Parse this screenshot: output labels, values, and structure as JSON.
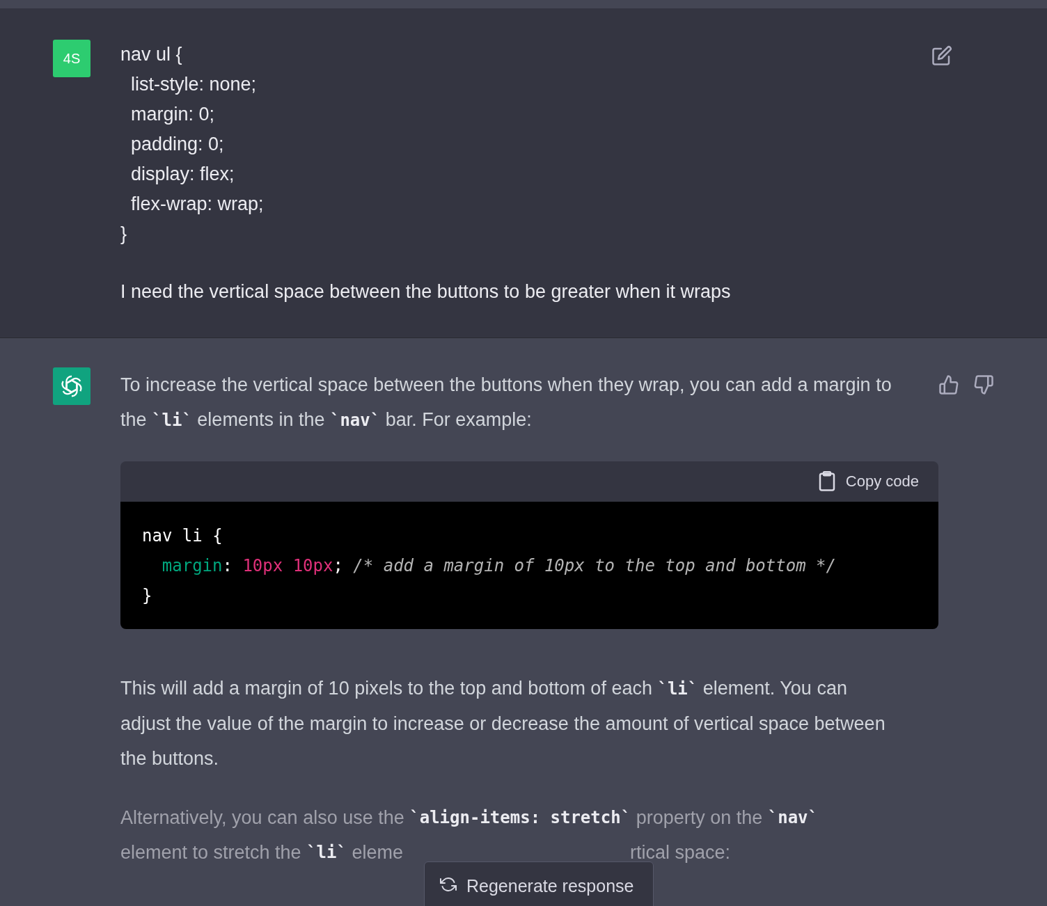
{
  "user_message": {
    "avatar": "4S",
    "lines": [
      "nav ul {",
      "  list-style: none;",
      "  margin: 0;",
      "  padding: 0;",
      "  display: flex;",
      "  flex-wrap: wrap;",
      "}"
    ],
    "question": "I need the vertical space between the buttons to be greater when it wraps"
  },
  "assistant_message": {
    "intro": [
      {
        "text": "To increase the vertical space between the buttons when they wrap, you can add a margin to the ",
        "code": false
      },
      {
        "text": "`li`",
        "code": true
      },
      {
        "text": " elements in the ",
        "code": false
      },
      {
        "text": "`nav`",
        "code": true
      },
      {
        "text": " bar. For example:",
        "code": false
      }
    ],
    "code_block": {
      "copy_label": "Copy code",
      "lines": [
        [
          {
            "text": "nav li {",
            "kind": "plain"
          }
        ],
        [
          {
            "text": "margin",
            "kind": "property"
          },
          {
            "text": ": ",
            "kind": "plain"
          },
          {
            "text": "10px 10px",
            "kind": "number"
          },
          {
            "text": "; ",
            "kind": "plain"
          },
          {
            "text": "/* add a margin of 10px to the top and bottom */",
            "kind": "comment"
          }
        ],
        [
          {
            "text": "}",
            "kind": "plain"
          }
        ]
      ]
    },
    "explanation": [
      {
        "text": "This will add a margin of 10 pixels to the top and bottom of each ",
        "code": false
      },
      {
        "text": "`li`",
        "code": true
      },
      {
        "text": " element. You can adjust the value of the margin to increase or decrease the amount of vertical space between the buttons.",
        "code": false
      }
    ],
    "alternative": {
      "first_line": [
        {
          "text": "Alternatively, you can also use the ",
          "code": false
        },
        {
          "text": "`align-items: stretch`",
          "code": true
        },
        {
          "text": " property on the ",
          "code": false
        },
        {
          "text": "`nav`",
          "code": true
        }
      ],
      "covered_line_before": [
        {
          "text": "element to stretch the ",
          "code": false
        },
        {
          "text": "`li`",
          "code": true
        },
        {
          "text": " eleme",
          "code": false
        }
      ],
      "covered_line_after": [
        {
          "text": "rtical space:",
          "code": false
        }
      ]
    }
  },
  "regenerate_button": {
    "label": "Regenerate response"
  }
}
